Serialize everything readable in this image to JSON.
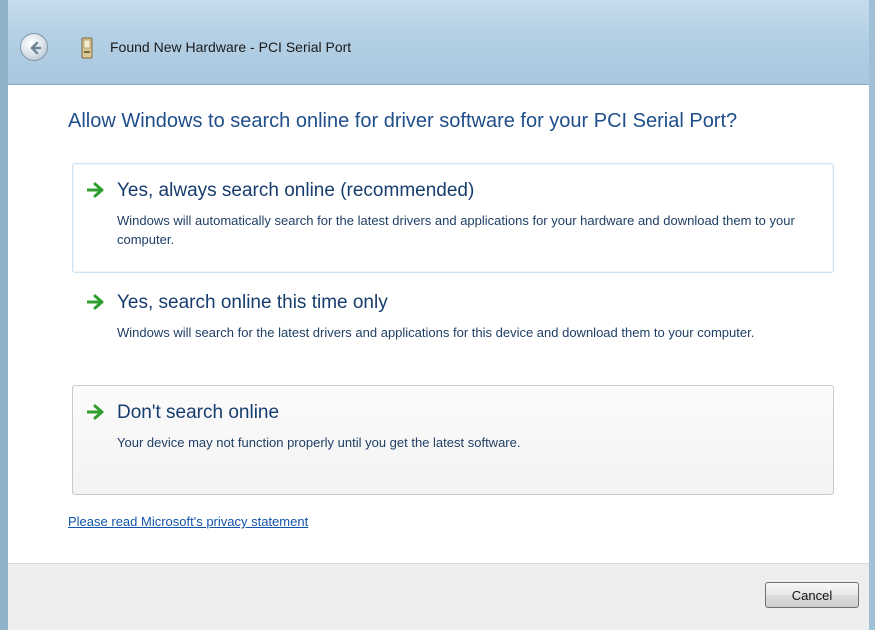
{
  "window": {
    "title": "Found New Hardware - PCI Serial Port"
  },
  "main": {
    "heading": "Allow Windows to search online for driver software for your PCI Serial Port?",
    "options": [
      {
        "title": "Yes, always search online (recommended)",
        "description": "Windows will automatically search for the latest drivers and applications for your hardware and download them to your computer.",
        "state": "hover"
      },
      {
        "title": "Yes, search online this time only",
        "description": "Windows will search for the latest drivers and applications for this device and download them to your computer.",
        "state": "normal"
      },
      {
        "title": "Don't search online",
        "description": "Your device may not function properly until you get the latest software.",
        "state": "focused"
      }
    ],
    "privacy_link": "Please read Microsoft's  privacy statement"
  },
  "footer": {
    "cancel_label": "Cancel"
  },
  "icons": {
    "back": "back-arrow-icon",
    "hardware": "hardware-device-icon",
    "option_arrow": "green-arrow-icon"
  },
  "colors": {
    "heading": "#1f4e8a",
    "arrow": "#2f9e2f",
    "link": "#1155aa"
  }
}
